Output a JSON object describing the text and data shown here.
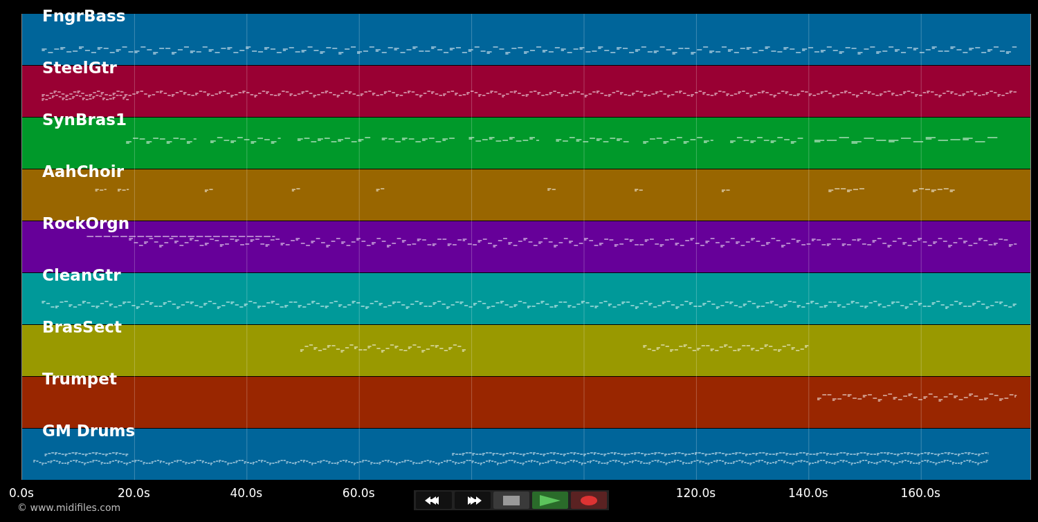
{
  "tracks": [
    {
      "name": "FngrBass",
      "color": "#00659a"
    },
    {
      "name": "SteelGtr",
      "color": "#990033"
    },
    {
      "name": "SynBras1",
      "color": "#00992a"
    },
    {
      "name": "AahChoir",
      "color": "#996600"
    },
    {
      "name": "RockOrgn",
      "color": "#660099"
    },
    {
      "name": "CleanGtr",
      "color": "#009999"
    },
    {
      "name": "BrasSect",
      "color": "#999900"
    },
    {
      "name": "Trumpet",
      "color": "#992600"
    },
    {
      "name": "GM Drums",
      "color": "#00659a"
    }
  ],
  "time_axis": {
    "ticks": [
      "0.0s",
      "20.0s",
      "40.0s",
      "60.0s",
      "120.0s",
      "140.0s",
      "160.0s"
    ]
  },
  "transport": [
    {
      "kind": "rewind"
    },
    {
      "kind": "forward"
    },
    {
      "kind": "stop"
    },
    {
      "kind": "play"
    },
    {
      "kind": "record"
    }
  ],
  "copyright": "© www.midifiles.com"
}
